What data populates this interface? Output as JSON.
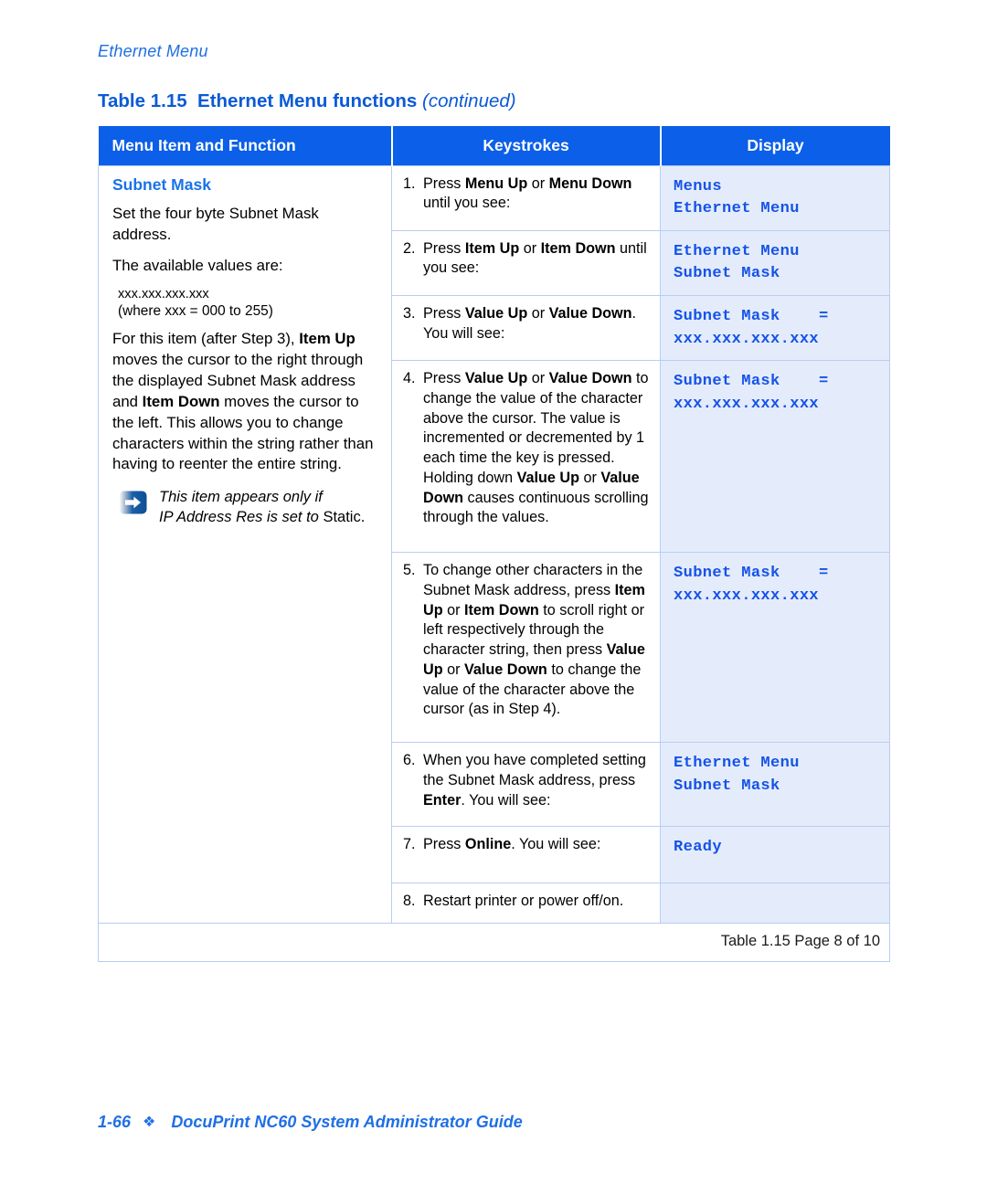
{
  "running_header": "Ethernet Menu",
  "table_caption": {
    "label": "Table 1.15",
    "title": "Ethernet Menu functions",
    "continued": "(continued)"
  },
  "colors": {
    "header_blue": "#0b5fe8",
    "accent_blue": "#1972e8",
    "display_bg": "#e4ecfb",
    "display_text": "#1552e8",
    "grid_line": "#b9cdf2"
  },
  "table_headers": {
    "col1": "Menu Item and Function",
    "col2": "Keystrokes",
    "col3": "Display"
  },
  "menu_item": {
    "title": "Subnet Mask",
    "para1": "Set the four byte Subnet Mask address.",
    "para2": "The available values are:",
    "values_line1": "xxx.xxx.xxx.xxx",
    "values_line2": "(where xxx = 000 to 255)",
    "para3_a": "For this item (after Step 3), ",
    "para3_b_bold": "Item Up",
    "para3_c": " moves the cursor to the right through the displayed Subnet Mask address and ",
    "para3_d_bold": "Item Down",
    "para3_e": " moves the cursor to the left. This allows you to change characters within the string rather than having to reenter the entire string.",
    "note_icon": "note-arrow-icon",
    "note_line1": "This item appears only if",
    "note_line2_italic": "IP Address Res is set to ",
    "note_line2_roman": "Static."
  },
  "steps": [
    {
      "number": "1.",
      "text_runs": [
        {
          "t": "Press ",
          "b": false
        },
        {
          "t": "Menu Up",
          "b": true
        },
        {
          "t": " or ",
          "b": false
        },
        {
          "t": "Menu Down",
          "b": true
        },
        {
          "t": " until you see:",
          "b": false
        }
      ],
      "display": "Menus\nEthernet Menu"
    },
    {
      "number": "2.",
      "text_runs": [
        {
          "t": "Press ",
          "b": false
        },
        {
          "t": "Item Up",
          "b": true
        },
        {
          "t": " or ",
          "b": false
        },
        {
          "t": "Item Down",
          "b": true
        },
        {
          "t": " until you see:",
          "b": false
        }
      ],
      "display": "Ethernet Menu\nSubnet Mask"
    },
    {
      "number": "3.",
      "text_runs": [
        {
          "t": "Press ",
          "b": false
        },
        {
          "t": "Value Up",
          "b": true
        },
        {
          "t": " or ",
          "b": false
        },
        {
          "t": "Value Down",
          "b": true
        },
        {
          "t": ". You will see:",
          "b": false
        }
      ],
      "display": "Subnet Mask    =\nxxx.xxx.xxx.xxx"
    },
    {
      "number": "4.",
      "text_runs": [
        {
          "t": "Press ",
          "b": false
        },
        {
          "t": "Value Up",
          "b": true
        },
        {
          "t": " or ",
          "b": false
        },
        {
          "t": "Value Down",
          "b": true
        },
        {
          "t": " to change the value of the character above the cursor. The value is incremented or decremented by 1 each time the key is pressed. Holding down ",
          "b": false
        },
        {
          "t": "Value Up",
          "b": true
        },
        {
          "t": " or ",
          "b": false
        },
        {
          "t": "Value Down",
          "b": true
        },
        {
          "t": " causes continuous scrolling through the values.",
          "b": false
        }
      ],
      "display": "Subnet Mask    =\nxxx.xxx.xxx.xxx"
    },
    {
      "number": "5.",
      "text_runs": [
        {
          "t": "To change other characters in the Subnet Mask address, press ",
          "b": false
        },
        {
          "t": "Item Up",
          "b": true
        },
        {
          "t": " or ",
          "b": false
        },
        {
          "t": "Item Down",
          "b": true
        },
        {
          "t": " to scroll right or left respectively through the character string, then press ",
          "b": false
        },
        {
          "t": "Value Up",
          "b": true
        },
        {
          "t": " or ",
          "b": false
        },
        {
          "t": "Value Down",
          "b": true
        },
        {
          "t": " to change the value of the character above the cursor (as in Step 4).",
          "b": false
        }
      ],
      "display": "Subnet Mask    =\nxxx.xxx.xxx.xxx"
    },
    {
      "number": "6.",
      "text_runs": [
        {
          "t": "When you have completed setting the Subnet Mask address, press ",
          "b": false
        },
        {
          "t": "Enter",
          "b": true
        },
        {
          "t": ". You will see:",
          "b": false
        }
      ],
      "display": "Ethernet Menu\nSubnet Mask"
    },
    {
      "number": "7.",
      "text_runs": [
        {
          "t": "Press ",
          "b": false
        },
        {
          "t": "Online",
          "b": true
        },
        {
          "t": ". You will see:",
          "b": false
        }
      ],
      "display": "Ready"
    },
    {
      "number": "8.",
      "text_runs": [
        {
          "t": "Restart printer or power off/on.",
          "b": false
        }
      ],
      "display": ""
    }
  ],
  "table_footer": "Table 1.15  Page 8 of 10",
  "page_footer": {
    "page_number": "1-66",
    "bullet": "❖",
    "guide_title": "DocuPrint NC60 System Administrator Guide"
  }
}
